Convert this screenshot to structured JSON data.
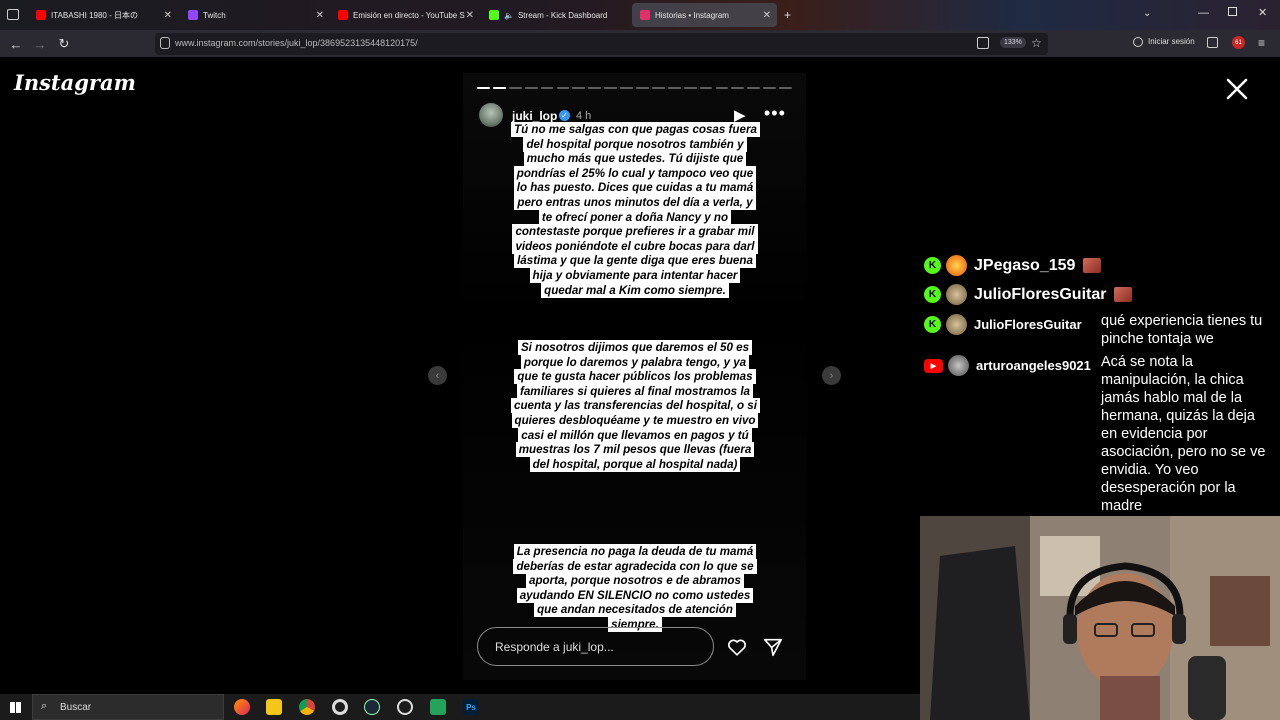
{
  "browser": {
    "tabs": [
      {
        "label": "ITABASHI 1980 - 日本の",
        "favicon": "youtube-icon",
        "color": "#ff0000"
      },
      {
        "label": "Twitch",
        "favicon": "twitch-icon",
        "color": "#9146ff"
      },
      {
        "label": "Emisión en directo - YouTube S",
        "favicon": "youtube-icon",
        "color": "#ff0000"
      },
      {
        "label": "Stream - Kick Dashboard",
        "favicon": "kick-icon",
        "color": "#53fc18"
      },
      {
        "label": "Historias • Instagram",
        "favicon": "instagram-icon",
        "color": "#e1306c"
      }
    ],
    "url": "www.instagram.com/stories/juki_lop/3869523135448120175/",
    "zoom": "133%",
    "signin_label": "Iniciar sesión",
    "notification_count": "61"
  },
  "instagram": {
    "logo": "Instagram",
    "story": {
      "username": "juki_lop",
      "time": "4 h",
      "segments_total": 20,
      "segments_done": 2,
      "paragraphs": [
        "Tú no me salgas con que pagas cosas fuera del hospital porque nosotros también y mucho más que ustedes. Tú dijiste que pondrías el 25% lo cual y tampoco veo que lo has puesto. Dices que cuidas a tu mamá pero entras unos minutos del día a verla, y te ofrecí poner a doña Nancy y no contestaste porque prefieres ir a grabar mil videos poniéndote el cubre bocas para darl lástima y que la gente diga que eres buena hija y obviamente para intentar hacer quedar mal a Kim como siempre.",
        "Si nosotros dijimos que daremos el 50 es porque lo daremos y palabra tengo, y ya que te gusta hacer públicos los problemas familiares si quieres al final mostramos la cuenta y las transferencias del hospital, o si quieres desbloquéame y te muestro en vivo casi el millón que llevamos en pagos y tú muestras los 7 mil pesos que llevas (fuera del hospital, porque al hospital nada)",
        "La presencia no paga la deuda de tu mamá deberías de estar agradecida con lo que se aporta, porque nosotros e de abramos ayudando EN SILENCIO no como ustedes que andan necesitados de atención siempre."
      ],
      "reply_placeholder": "Responde a juki_lop..."
    }
  },
  "chat": {
    "messages": [
      {
        "platform": "kick",
        "user": "JPegaso_159",
        "text": ""
      },
      {
        "platform": "kick",
        "user": "JulioFloresGuitar",
        "text": ""
      },
      {
        "platform": "kick",
        "user": "JulioFloresGuitar",
        "text": "qué experiencia tienes tu pinche tontaja we"
      },
      {
        "platform": "youtube",
        "user": "arturoangeles9021",
        "text": "Acá se nota la manipulación, la chica jamás hablo mal de la hermana, quizás la deja en evidencia por asociación, pero no se ve envidia. Yo veo desesperación por la madre"
      }
    ]
  },
  "taskbar": {
    "search_label": "Buscar"
  }
}
